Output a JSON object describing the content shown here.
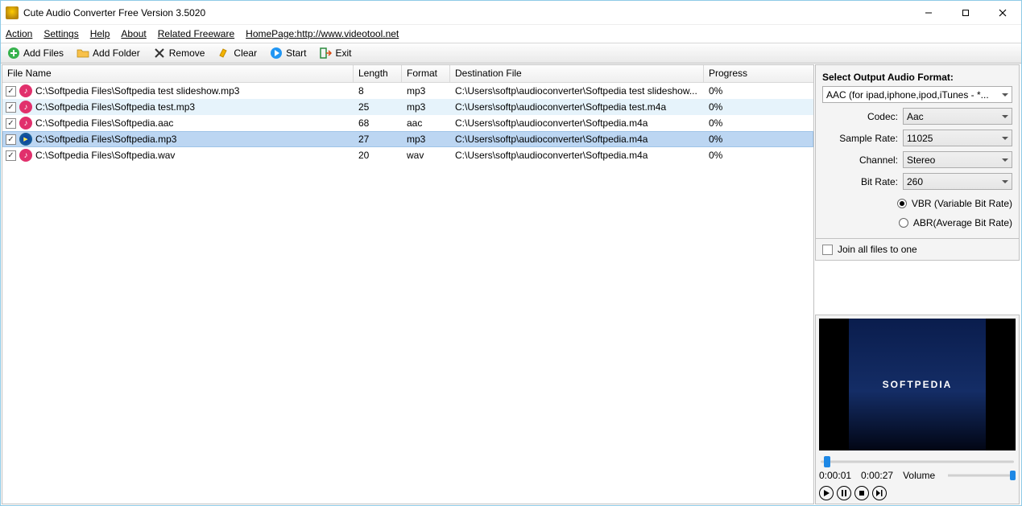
{
  "window": {
    "title": "Cute Audio Converter Free Version 3.5020"
  },
  "menu": {
    "items": [
      "Action",
      "Settings",
      "Help",
      "About",
      "Related Freeware",
      "HomePage:http://www.videotool.net"
    ]
  },
  "toolbar": {
    "add_files": "Add Files",
    "add_folder": "Add Folder",
    "remove": "Remove",
    "clear": "Clear",
    "start": "Start",
    "exit": "Exit"
  },
  "columns": {
    "file": "File Name",
    "length": "Length",
    "format": "Format",
    "dest": "Destination File",
    "progress": "Progress"
  },
  "files": [
    {
      "checked": true,
      "playing": false,
      "name": "C:\\Softpedia Files\\Softpedia test slideshow.mp3",
      "length": "8",
      "format": "mp3",
      "dest": "C:\\Users\\softp\\audioconverter\\Softpedia test slideshow...",
      "progress": "0%",
      "state": ""
    },
    {
      "checked": true,
      "playing": false,
      "name": "C:\\Softpedia Files\\Softpedia test.mp3",
      "length": "25",
      "format": "mp3",
      "dest": "C:\\Users\\softp\\audioconverter\\Softpedia test.m4a",
      "progress": "0%",
      "state": "hover"
    },
    {
      "checked": true,
      "playing": false,
      "name": "C:\\Softpedia Files\\Softpedia.aac",
      "length": "68",
      "format": "aac",
      "dest": "C:\\Users\\softp\\audioconverter\\Softpedia.m4a",
      "progress": "0%",
      "state": ""
    },
    {
      "checked": true,
      "playing": true,
      "name": "C:\\Softpedia Files\\Softpedia.mp3",
      "length": "27",
      "format": "mp3",
      "dest": "C:\\Users\\softp\\audioconverter\\Softpedia.m4a",
      "progress": "0%",
      "state": "selected"
    },
    {
      "checked": true,
      "playing": false,
      "name": "C:\\Softpedia Files\\Softpedia.wav",
      "length": "20",
      "format": "wav",
      "dest": "C:\\Users\\softp\\audioconverter\\Softpedia.m4a",
      "progress": "0%",
      "state": ""
    }
  ],
  "side": {
    "format_label": "Select  Output Audio Format:",
    "format_value": "AAC (for ipad,iphone,ipod,iTunes - *...",
    "codec_label": "Codec:",
    "codec_value": "Aac",
    "sample_label": "Sample Rate:",
    "sample_value": "11025",
    "channel_label": "Channel:",
    "channel_value": "Stereo",
    "bitrate_label": "Bit Rate:",
    "bitrate_value": "260",
    "vbr_label": "VBR (Variable Bit Rate)",
    "abr_label": "ABR(Average Bit Rate)",
    "join_label": "Join all files to one"
  },
  "preview": {
    "brand": "SOFTPEDIA",
    "time_cur": "0:00:01",
    "time_tot": "0:00:27",
    "volume_label": "Volume",
    "progress_pct": 4
  }
}
